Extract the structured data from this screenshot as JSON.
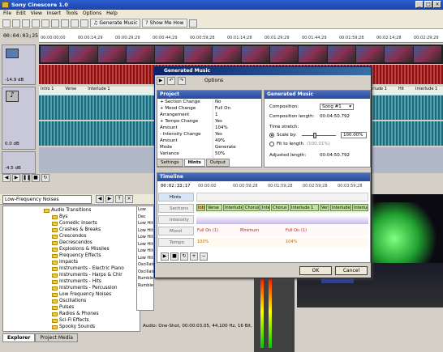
{
  "app": {
    "title": "Sony Cinescore 1.0"
  },
  "menu": [
    "File",
    "Edit",
    "View",
    "Insert",
    "Tools",
    "Options",
    "Help"
  ],
  "toolbar": {
    "generate_label": "Generate Music",
    "showme_label": "Show Me How"
  },
  "main": {
    "timecode": "00:04:03;25",
    "ruler": [
      "00:00:00;00",
      "00:00:14;29",
      "00:00:29;29",
      "00:00:44;29",
      "00:00:59;28",
      "00:01:14;28",
      "00:01:29;29",
      "00:01:44;29",
      "00:01:59;28",
      "00:02:14;28",
      "00:02:29;29"
    ],
    "tracks": {
      "level1": "-14.9 dB",
      "level2": "0.0 dB",
      "level3": "-4.5 dB"
    },
    "music_labels": [
      "Intro 1",
      "Verse",
      "Interlude 1",
      "Chorus",
      "Verse",
      "Int",
      "Interlude 1",
      "Ver",
      "Interlude 1",
      "Hit",
      "Interlude 1"
    ]
  },
  "explorer": {
    "location": "Low-Frequency Noises",
    "tree": [
      "Audio Transitions",
      "Bys",
      "Comedic Inserts",
      "Crashes & Breaks",
      "Crescendos",
      "Decrescendos",
      "Explosions & Missiles",
      "Frequency Effects",
      "Impacts",
      "Instruments - Electric Piano",
      "Instruments - Harps & Chir",
      "Instruments - Hits",
      "Instruments - Percussion",
      "Low Frequency Noises",
      "Oscillations",
      "Pulses",
      "Radios & Phones",
      "Sci-Fi Effects",
      "Spooky Sounds",
      "Sweeps"
    ],
    "files": [
      "Low Dec",
      "Low Hit",
      "Low Hit",
      "Low Hit",
      "Low Hit",
      "Low Hit",
      "Low Hit",
      "Oscillate",
      "Oscillate",
      "Rumble",
      "Rumble"
    ],
    "status": "Audio: One-Shot, 00:00:03.05, 44,100 Hz, 16 Bit, Mono, 0.",
    "tabs": [
      "Explorer",
      "Project Media"
    ]
  },
  "dialog": {
    "title": "Generated Music",
    "options_label": "Options",
    "project_head": "Project",
    "project": [
      {
        "k": "+ Section Change",
        "v": "No"
      },
      {
        "k": "+ Mood Change",
        "v": "Full On"
      },
      {
        "k": "  Arrangement",
        "v": "1"
      },
      {
        "k": "+ Tempo Change",
        "v": "Yes"
      },
      {
        "k": "  Amount",
        "v": "104%"
      },
      {
        "k": "- Intensity Change",
        "v": "Yes"
      },
      {
        "k": "  Amount",
        "v": "49%"
      },
      {
        "k": "  Mode",
        "v": "Generate"
      },
      {
        "k": "  Variance",
        "v": "50%"
      }
    ],
    "gen_head": "Generated Music",
    "composition_label": "Composition:",
    "composition_value": "Song #1",
    "comp_length_label": "Composition length:",
    "comp_length_value": "00:04:50.792",
    "stretch_label": "Time stretch:",
    "scale_label": "Scale by:",
    "scale_value": "100.00%",
    "fit_label": "Fit to length",
    "fit_value": "(100.01%)",
    "adjusted_label": "Adjusted length:",
    "adjusted_value": "00:04:50.792",
    "panel_tabs": [
      "Settings",
      "Hints",
      "Output"
    ],
    "timeline_head": "Timeline",
    "tl_timecode": "00:02:33;17",
    "tl_ruler": [
      "00:00:00",
      "00:00:59;28",
      "00:01:59;28",
      "00:02:59;28",
      "00:03:59;28"
    ],
    "tl_rows": [
      "Hints",
      "Sections",
      "Intensity",
      "Mood",
      "Tempo"
    ],
    "sections": [
      "Intr",
      "Verse",
      "Interlude",
      "Chorus",
      "Inte",
      "Chorus",
      "Interlude 1",
      "Ver",
      "Interlude 1",
      "Interlud"
    ],
    "mood": [
      "Full On (1)",
      "Minimum",
      "Full On (1)"
    ],
    "tempo": [
      "100%",
      "104%"
    ],
    "ok_label": "OK",
    "cancel_label": "Cancel"
  }
}
